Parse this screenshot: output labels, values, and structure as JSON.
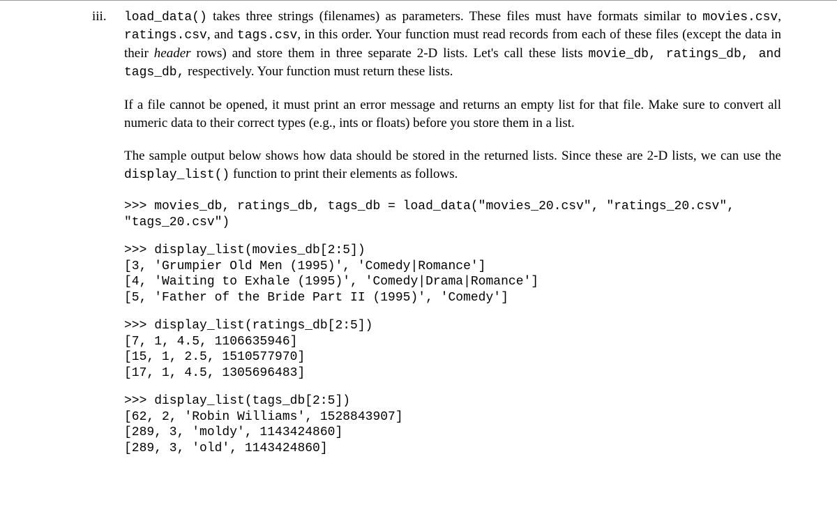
{
  "marker": "iii.",
  "para1": {
    "t1": "load_data()",
    "t2": " takes three strings (filenames) as parameters. These files must have formats similar to ",
    "t3": "movies.csv",
    "t4": ", ",
    "t5": "ratings.csv",
    "t6": ", and ",
    "t7": "tags.csv",
    "t8": ", in this order. Your function must read records from each of these files (except the data in their ",
    "t9": "header",
    "t10": " rows) and store them in three separate 2-D lists. Let's call these lists ",
    "t11": "movie_db, ratings_db, and tags_db,",
    "t12": " respectively. Your function must return these lists."
  },
  "para2": "If a file cannot be opened, it must print an error message and returns an empty list for that file. Make sure to convert all numeric data to their correct types (e.g., ints or floats) before you store them in a list.",
  "para3": {
    "t1": "The sample output below shows how data should be stored in the returned lists. Since these are 2-D lists, we can use the ",
    "t2": "display_list()",
    "t3": " function to print their elements as follows."
  },
  "code1": ">>> movies_db, ratings_db, tags_db = load_data(\"movies_20.csv\", \"ratings_20.csv\",\n\"tags_20.csv\")",
  "code2": ">>> display_list(movies_db[2:5])\n[3, 'Grumpier Old Men (1995)', 'Comedy|Romance']\n[4, 'Waiting to Exhale (1995)', 'Comedy|Drama|Romance']\n[5, 'Father of the Bride Part II (1995)', 'Comedy']",
  "code3": ">>> display_list(ratings_db[2:5])\n[7, 1, 4.5, 1106635946]\n[15, 1, 2.5, 1510577970]\n[17, 1, 4.5, 1305696483]",
  "code4": ">>> display_list(tags_db[2:5])\n[62, 2, 'Robin Williams', 1528843907]\n[289, 3, 'moldy', 1143424860]\n[289, 3, 'old', 1143424860]"
}
